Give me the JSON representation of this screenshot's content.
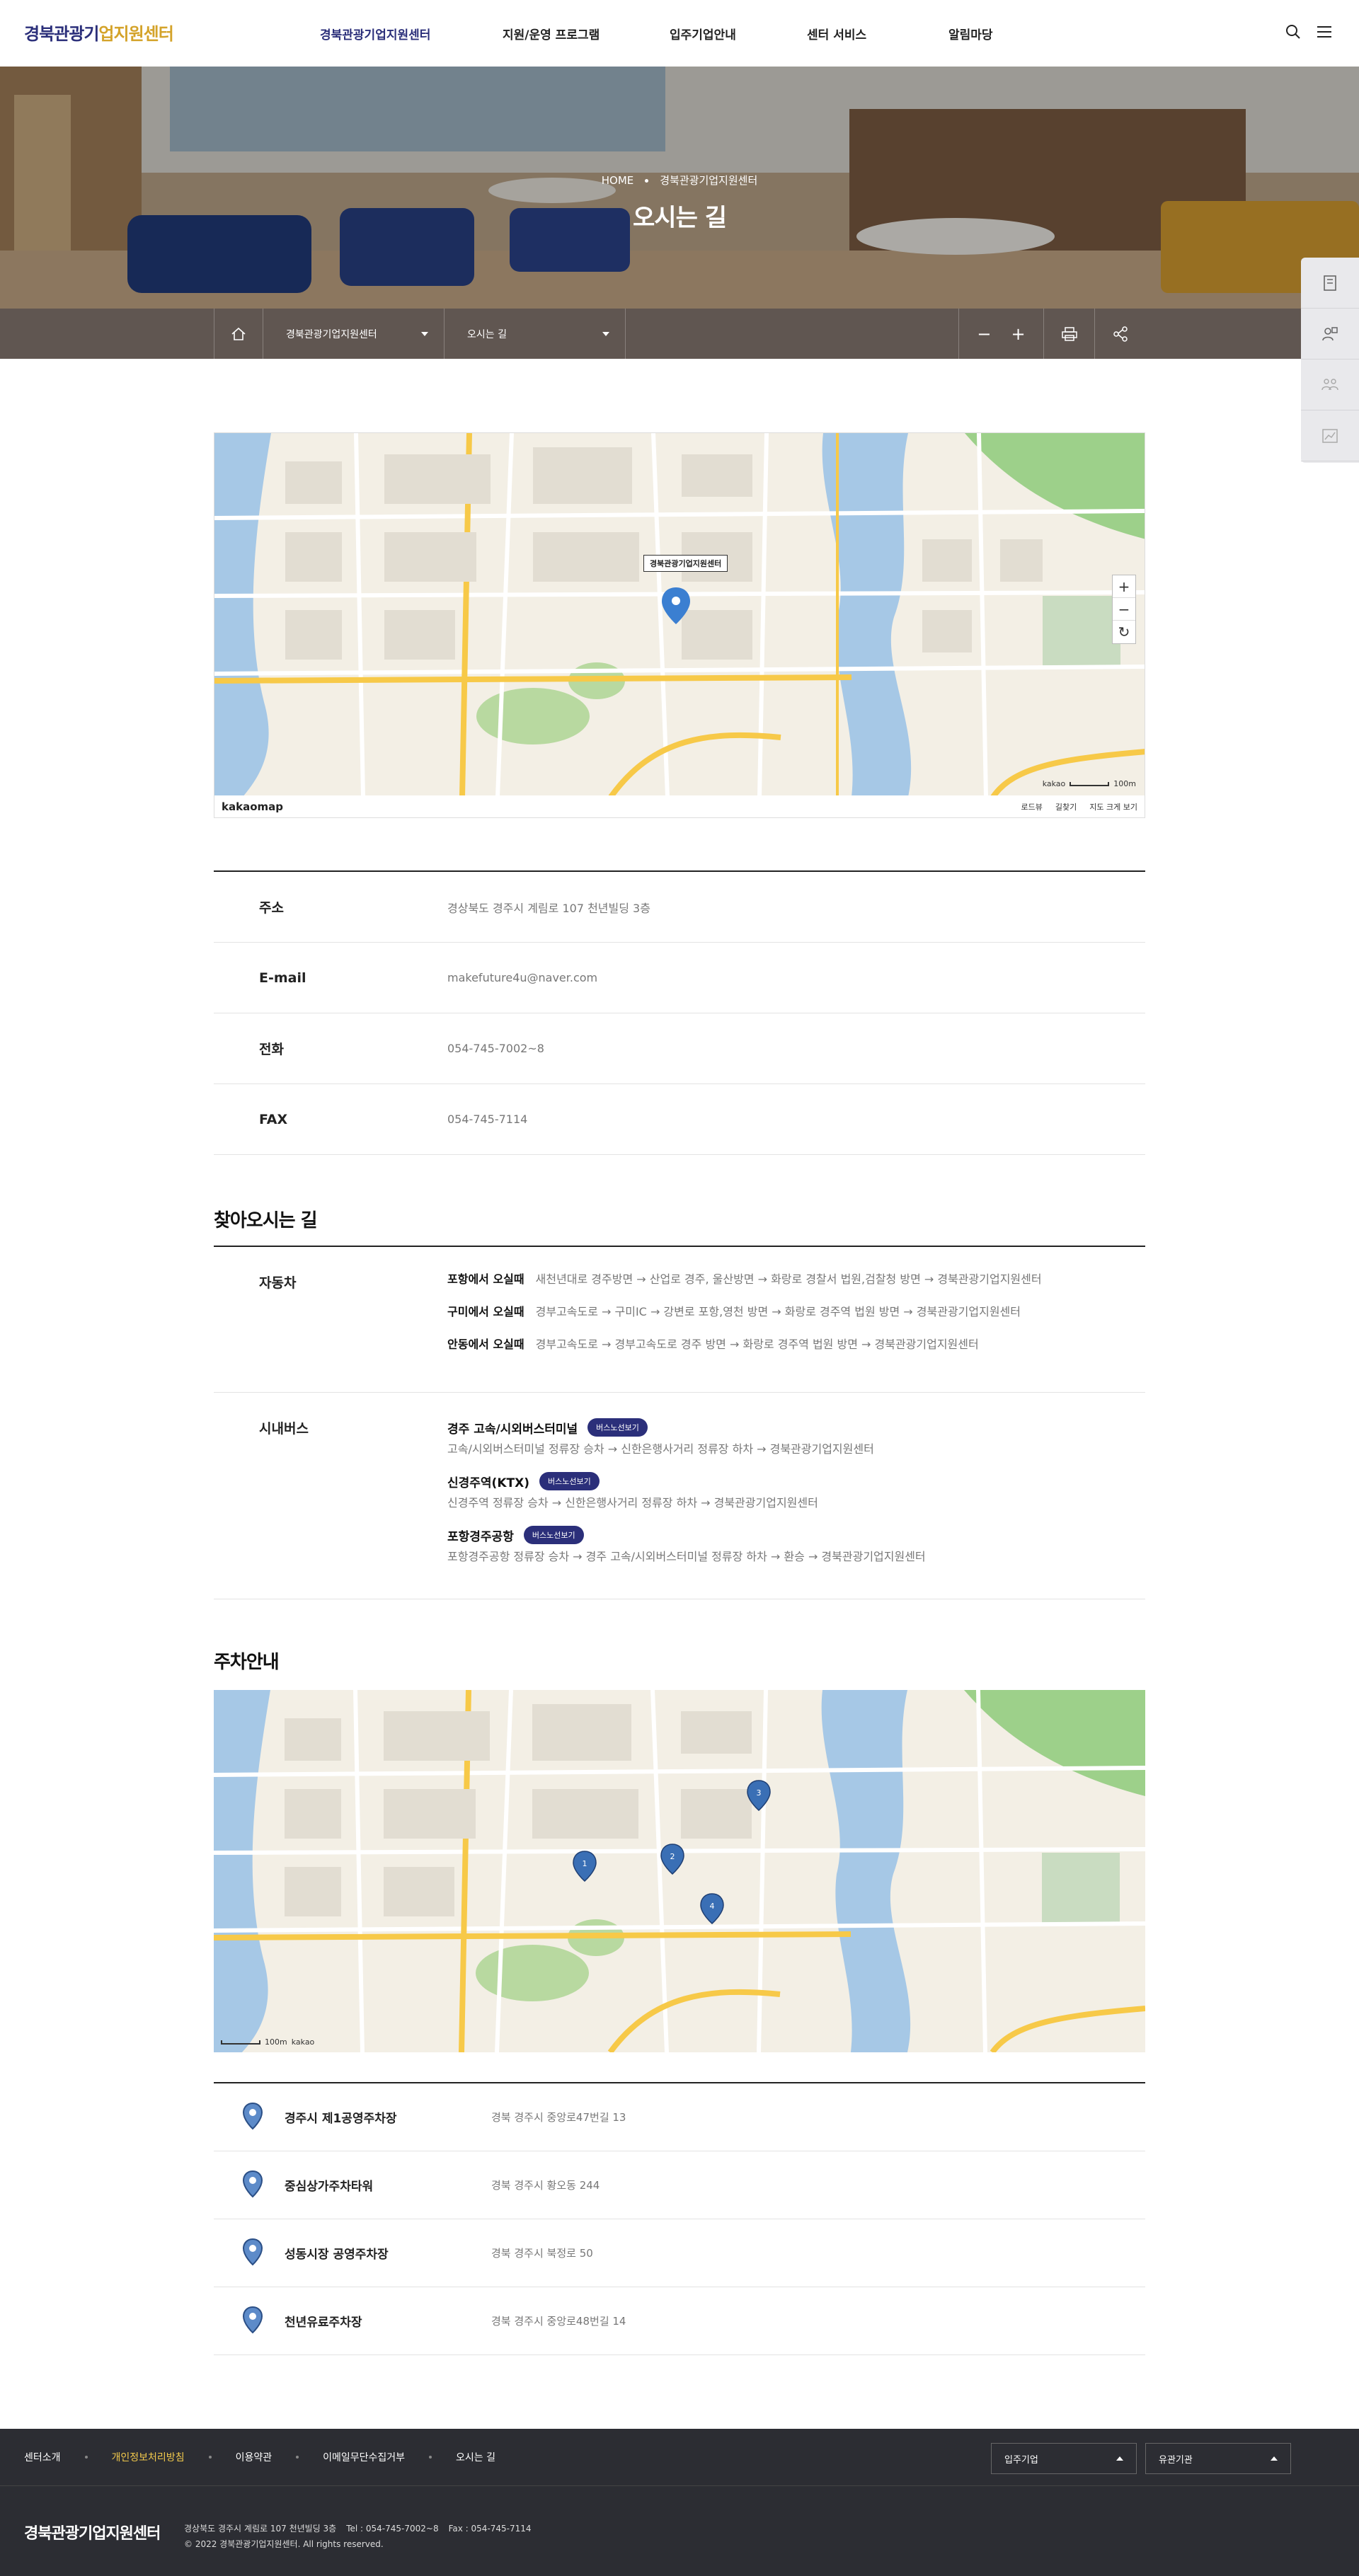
{
  "header": {
    "logo_part1": "경북관광기",
    "logo_part2": "업지원센터",
    "nav": [
      {
        "label": "경북관광기업지원센터",
        "active": true
      },
      {
        "label": "지원/운영 프로그램",
        "active": false
      },
      {
        "label": "입주기업안내",
        "active": false
      },
      {
        "label": "센터 서비스",
        "active": false
      },
      {
        "label": "알림마당",
        "active": false
      }
    ],
    "search_icon": "search-icon",
    "menu_icon": "hamburger-icon"
  },
  "hero": {
    "breadcrumb_home": "HOME",
    "breadcrumb_current": "경북관광기업지원센터",
    "title": "오시는 길"
  },
  "subnav": {
    "depth1": "경북관광기업지원센터",
    "depth2": "오시는 길",
    "zoom_out": "−",
    "zoom_in": "+"
  },
  "map": {
    "place_label": "경북관광기업지원센터",
    "kakao": "kakao",
    "scale": "100m",
    "logo": "kakaomap",
    "links": [
      "로드뷰",
      "길찾기",
      "지도 크게 보기"
    ],
    "zoom_plus": "+",
    "zoom_minus": "−"
  },
  "info": [
    {
      "label": "주소",
      "value": "경상북도 경주시 계림로 107 천년빌딩 3층"
    },
    {
      "label": "E-mail",
      "value": "makefuture4u@naver.com"
    },
    {
      "label": "전화",
      "value": "054-745-7002~8"
    },
    {
      "label": "FAX",
      "value": "054-745-7114"
    }
  ],
  "directions": {
    "title": "찾아오시는 길",
    "car": {
      "label": "자동차",
      "lines": [
        {
          "from": "포항에서 오실때",
          "route": "새천년대로 경주방면 → 산업로 경주, 울산방면 → 화랑로 경찰서 법원,검찰청 방면 → 경북관광기업지원센터"
        },
        {
          "from": "구미에서 오실때",
          "route": "경부고속도로 → 구미IC → 강변로 포항,영천 방면 → 화랑로 경주역 법원 방면 → 경북관광기업지원센터"
        },
        {
          "from": "안동에서 오실때",
          "route": "경부고속도로 → 경부고속도로 경주 방면 → 화랑로 경주역 법원 방면 → 경북관광기업지원센터"
        }
      ]
    },
    "bus": {
      "label": "시내버스",
      "items": [
        {
          "name": "경주 고속/시외버스터미널",
          "button": "버스노선보기",
          "route": "고속/시외버스터미널 정류장 승차 → 신한은행사거리 정류장 하차 → 경북관광기업지원센터"
        },
        {
          "name": "신경주역(KTX)",
          "button": "버스노선보기",
          "route": "신경주역 정류장 승차 → 신한은행사거리 정류장 하차 → 경북관광기업지원센터"
        },
        {
          "name": "포항경주공항",
          "button": "버스노선보기",
          "route": "포항경주공항 정류장 승차 → 경주 고속/시외버스터미널 정류장 하차 → 환승 → 경북관광기업지원센터"
        }
      ]
    }
  },
  "parking": {
    "title": "주차안내",
    "map_scale": "100m",
    "map_logo": "kakao",
    "items": [
      {
        "name": "경주시 제1공영주차장",
        "address": "경북 경주시 중앙로47번길 13",
        "pin": "1"
      },
      {
        "name": "중심상가주차타워",
        "address": "경북 경주시 황오동 244",
        "pin": "2"
      },
      {
        "name": "성동시장 공영주차장",
        "address": "경북 경주시 북정로 50",
        "pin": "3"
      },
      {
        "name": "천년유료주차장",
        "address": "경북 경주시 중앙로48번길 14",
        "pin": "4"
      }
    ]
  },
  "footer": {
    "links": [
      {
        "label": "센터소개",
        "highlight": false
      },
      {
        "label": "개인정보처리방침",
        "highlight": true
      },
      {
        "label": "이용약관",
        "highlight": false
      },
      {
        "label": "이메일무단수집거부",
        "highlight": false
      },
      {
        "label": "오시는 길",
        "highlight": false
      }
    ],
    "select1": "입주기업",
    "select2": "유관기관",
    "logo": "경북관광기업지원센터",
    "address": "경상북도 경주시 계림로 107 천년빌딩 3층",
    "tel": "Tel : 054-745-7002~8",
    "fax": "Fax : 054-745-7114",
    "copyright": "© 2022 경북관광기업지원센터. All rights reserved."
  },
  "colors": {
    "brand": "#2b2f7a",
    "accent": "#d4a32a",
    "footer_bg": "#2c2d33",
    "footer_highlight": "#f2c94c"
  }
}
